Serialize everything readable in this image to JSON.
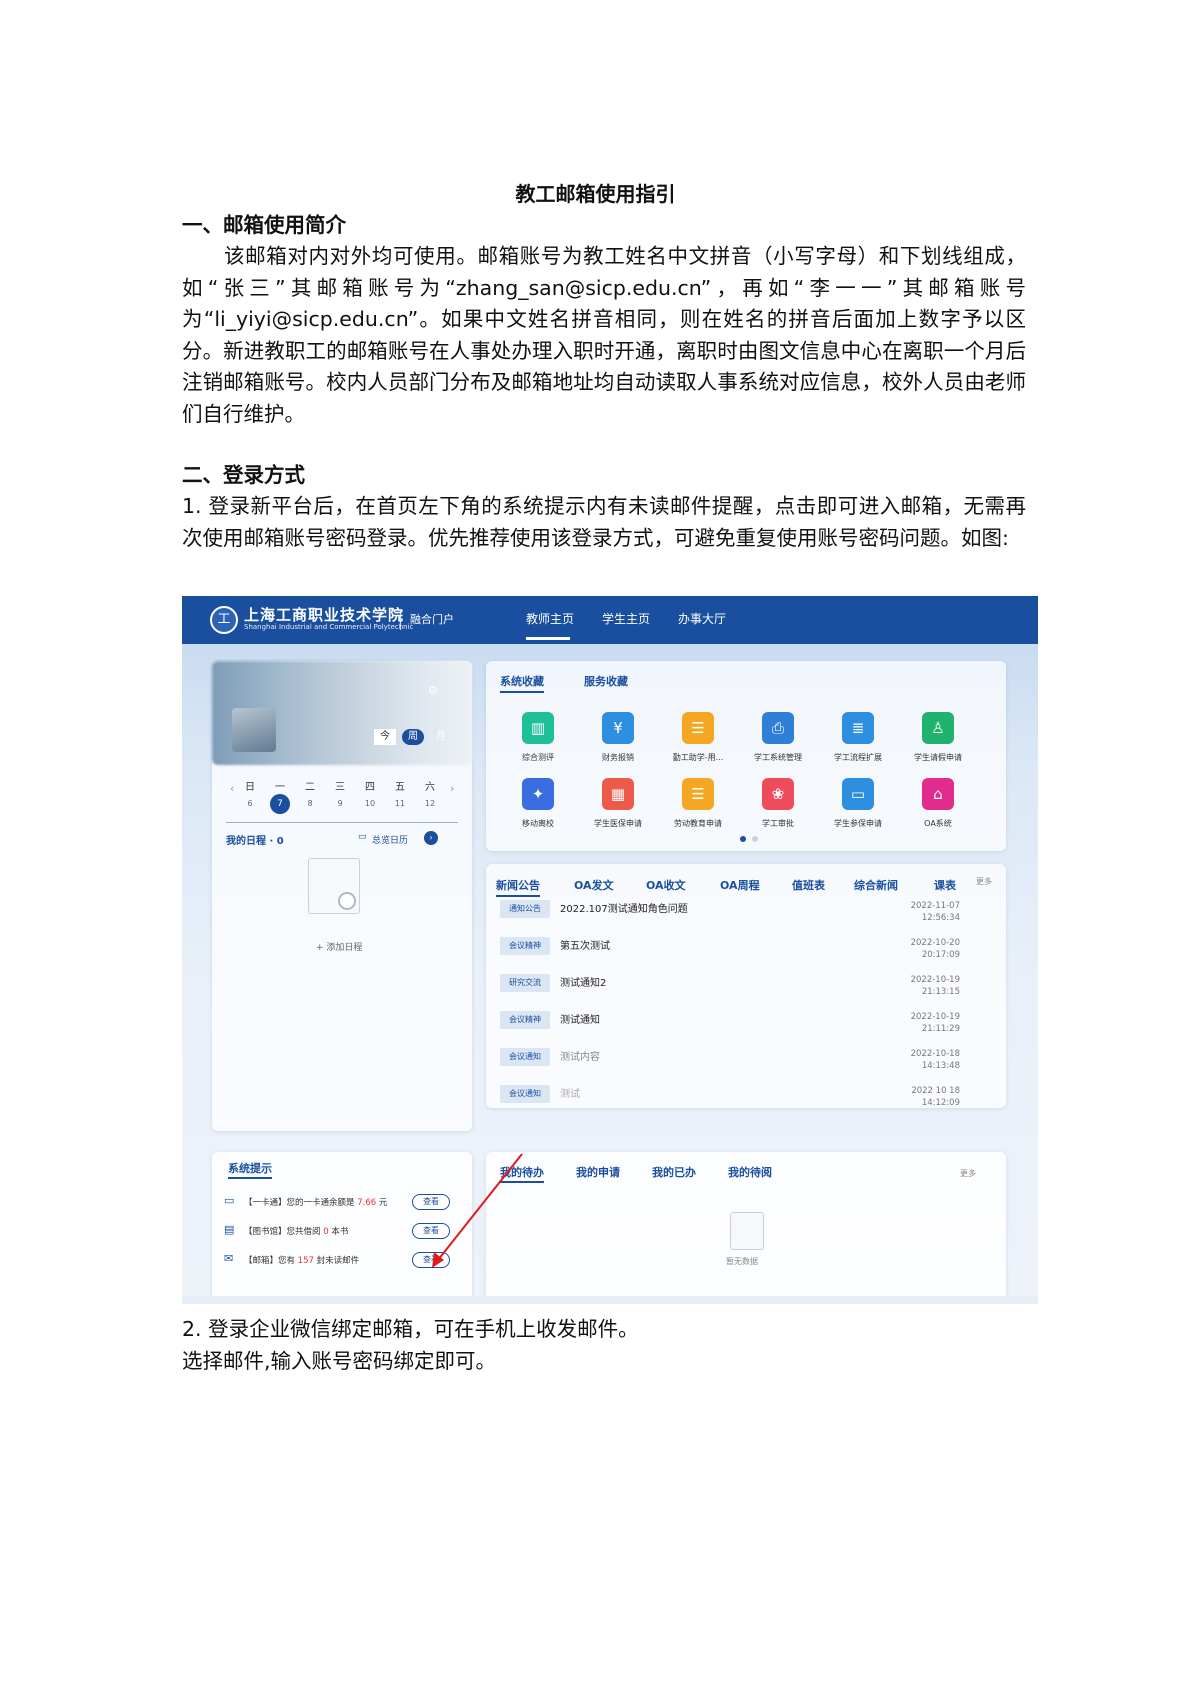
{
  "doc": {
    "title": "教工邮箱使用指引",
    "section1_heading": "一、邮箱使用简介",
    "section1_paragraph": "该邮箱对内对外均可使用。邮箱账号为教工姓名中文拼音（小写字母）和下划线组成，如“张三”其邮箱账号为“zhang_san@sicp.edu.cn”，再如“李一一”其邮箱账号为“li_yiyi@sicp.edu.cn”。如果中文姓名拼音相同，则在姓名的拼音后面加上数字予以区分。新进教职工的邮箱账号在人事处办理入职时开通，离职时由图文信息中心在离职一个月后注销邮箱账号。校内人员部门分布及邮箱地址均自动读取人事系统对应信息，校外人员由老师们自行维护。",
    "section2_heading": "二、登录方式",
    "section2_item1": "1. 登录新平台后，在首页左下角的系统提示内有未读邮件提醒，点击即可进入邮箱，无需再次使用邮箱账号密码登录。优先推荐使用该登录方式，可避免重复使用账号密码问题。如图:",
    "section2_item2": "2.  登录企业微信绑定邮箱，可在手机上收发邮件。",
    "section2_item2_cont": "选择邮件,输入账号密码绑定即可。"
  },
  "screenshot": {
    "logo_char": "工",
    "school_name": "上海工商职业技术学院",
    "school_en": "Shanghai Industrial and Commercial Polytechnic",
    "portal": "融合门户",
    "nav": [
      "教师主页",
      "学生主页",
      "办事大厅"
    ],
    "view_toggle": [
      "今",
      "周",
      "月"
    ],
    "weekdays": [
      "日",
      "一",
      "二",
      "三",
      "四",
      "五",
      "六"
    ],
    "days": [
      "6",
      "7",
      "8",
      "9",
      "10",
      "11",
      "12"
    ],
    "my_schedule": "我的日程 · 0",
    "total_calendar": "总览日历",
    "add_schedule": "+ 添加日程",
    "fav_tabs": [
      "系统收藏",
      "服务收藏"
    ],
    "apps": [
      "综合测评",
      "财务报销",
      "勤工助学-用...",
      "学工系统管理",
      "学工流程扩展",
      "学生请假申请",
      "移动离校",
      "学生医保申请",
      "劳动教育申请",
      "学工审批",
      "学生参保申请",
      "OA系统"
    ],
    "news_tabs": [
      "新闻公告",
      "OA发文",
      "OA收文",
      "OA周程",
      "值班表",
      "综合新闻",
      "课表"
    ],
    "more": "更多",
    "news": [
      {
        "tag": "通知公告",
        "title": "2022.107测试通知角色问题",
        "date": "2022-11-07",
        "time": "12:56:34"
      },
      {
        "tag": "会议精神",
        "title": "第五次测试",
        "date": "2022-10-20",
        "time": "20:17:09"
      },
      {
        "tag": "研究交流",
        "title": "测试通知2",
        "date": "2022-10-19",
        "time": "21:13:15"
      },
      {
        "tag": "会议精神",
        "title": "测试通知",
        "date": "2022-10-19",
        "time": "21:11:29"
      },
      {
        "tag": "会议通知",
        "title": "测试内容",
        "date": "2022-10-18",
        "time": "14:13:48"
      },
      {
        "tag": "会议通知",
        "title": "测试",
        "date": "2022 10 18",
        "time": "14:12:09"
      }
    ],
    "tips_title": "系统提示",
    "tips": [
      {
        "prefix": "【一卡通】您的一卡通余额是 ",
        "value": "7.66",
        "suffix": " 元",
        "button": "查看"
      },
      {
        "prefix": "【图书馆】您共借阅 ",
        "value": "0",
        "suffix": " 本书",
        "button": "查看"
      },
      {
        "prefix": "【邮箱】您有 ",
        "value": "157",
        "suffix": " 封未读邮件",
        "button": "查看"
      }
    ],
    "todo_tabs": [
      "我的待办",
      "我的申请",
      "我的已办",
      "我的待阅"
    ],
    "no_data": "暂无数据",
    "colors": {
      "brand": "#1a4e9f",
      "accent_red": "#e33333"
    }
  }
}
